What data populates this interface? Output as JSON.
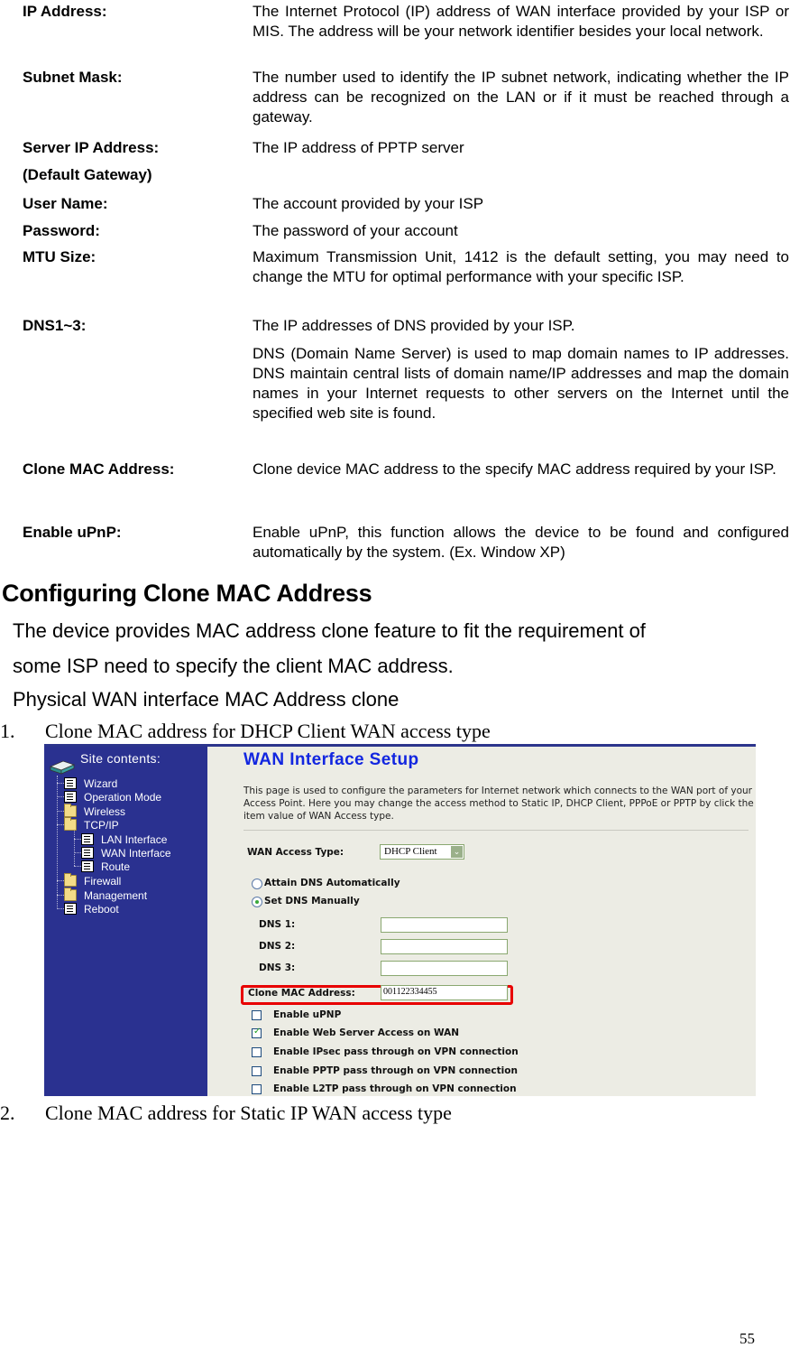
{
  "definitions": [
    {
      "term": "IP Address:",
      "desc": [
        "The Internet Protocol (IP) address of WAN interface provided by your ISP or MIS. The address will be your network  identifier besides your local network."
      ]
    },
    {
      "term": "Subnet Mask:",
      "desc": [
        "The number used to identify the IP subnet  network, indicating whether the IP address can be recognized on the LAN or if it must be reached through a gateway."
      ]
    },
    {
      "term": "Server IP Address:",
      "term2": "(Default Gateway)",
      "desc": [
        "The IP address of PPTP server"
      ]
    },
    {
      "term": "User Name:",
      "desc": [
        "The account provided by your ISP"
      ]
    },
    {
      "term": "Password:",
      "desc": [
        "The password of your account"
      ]
    },
    {
      "term": "MTU Size:",
      "desc": [
        "Maximum Transmission Unit, 1412 is the default setting, you may need to change the MTU for optimal performance with your specific ISP."
      ]
    },
    {
      "term": "DNS1~3:",
      "desc": [
        "The IP addresses of DNS provided by your ISP.",
        "DNS (Domain Name Server) is used to map domain names to IP addresses. DNS maintain central lists of domain name/IP addresses and map the domain names in your Internet requests to other servers on the Internet until the specified web site is found."
      ]
    },
    {
      "term": "Clone MAC Address:",
      "desc": [
        "Clone device MAC address to the specify MAC address required by your ISP."
      ]
    },
    {
      "term": "Enable uPnP:",
      "desc": [
        "Enable uPnP, this function allows  the device to be found and configured automatically by the system. (Ex. Window XP)"
      ]
    }
  ],
  "section": {
    "title": "Configuring Clone MAC Address",
    "intro_line1": "The device provides MAC address clone feature to fit the requirement of",
    "intro_line2": "some ISP need to specify the client MAC address.",
    "intro_line3": "Physical WAN interface MAC Address clone",
    "steps": [
      {
        "num": "1.",
        "text": "Clone MAC address for DHCP Client WAN access type"
      },
      {
        "num": "2.",
        "text": "Clone MAC address for Static IP WAN access type"
      }
    ]
  },
  "screenshot": {
    "sidebar": {
      "title": "Site contents:",
      "items": [
        {
          "label": "Wizard",
          "icon": "document-icon"
        },
        {
          "label": "Operation Mode",
          "icon": "document-icon"
        },
        {
          "label": "Wireless",
          "icon": "folder-icon"
        },
        {
          "label": "TCP/IP",
          "icon": "folder-open-icon"
        },
        {
          "label": "LAN Interface",
          "icon": "document-icon"
        },
        {
          "label": "WAN Interface",
          "icon": "document-icon"
        },
        {
          "label": "Route",
          "icon": "document-icon"
        },
        {
          "label": "Firewall",
          "icon": "folder-icon"
        },
        {
          "label": "Management",
          "icon": "folder-icon"
        },
        {
          "label": "Reboot",
          "icon": "document-icon"
        }
      ]
    },
    "page_title": "WAN Interface Setup",
    "page_description": "This page is used to configure the parameters for Internet network which connects to the WAN port of your Access Point. Here you may change the access method to Static IP, DHCP Client, PPPoE or PPTP by click the item value of WAN Access type.",
    "wan_access_type_label": "WAN Access Type:",
    "wan_access_type_value": "DHCP Client",
    "dns_options": [
      {
        "label": "Attain DNS Automatically",
        "selected": false
      },
      {
        "label": "Set DNS Manually",
        "selected": true
      }
    ],
    "dns_fields": [
      {
        "label": "DNS 1:",
        "value": ""
      },
      {
        "label": "DNS 2:",
        "value": ""
      },
      {
        "label": "DNS 3:",
        "value": ""
      }
    ],
    "clone_mac_label": "Clone MAC Address:",
    "clone_mac_value": "001122334455",
    "checkboxes": [
      {
        "label": "Enable uPNP",
        "checked": false
      },
      {
        "label": "Enable Web Server Access on WAN",
        "checked": true
      },
      {
        "label": "Enable IPsec pass through on VPN connection",
        "checked": false
      },
      {
        "label": "Enable PPTP pass through on VPN connection",
        "checked": false
      },
      {
        "label": "Enable L2TP pass through on VPN connection",
        "checked": false
      }
    ],
    "colors": {
      "sidebar": "#2a3190",
      "title": "#1226e0",
      "highlight": "#e80000"
    }
  },
  "page_number": "55"
}
